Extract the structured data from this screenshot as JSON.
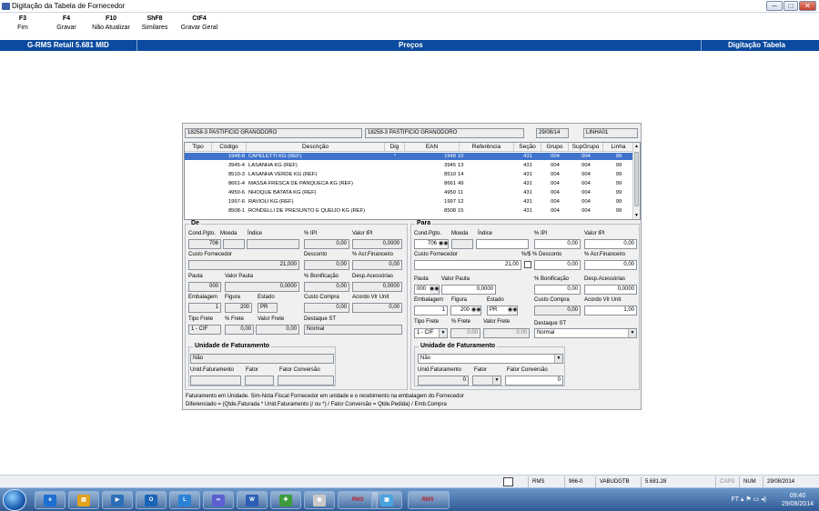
{
  "window": {
    "title": "Digitação da Tabela de Fornecedor",
    "controls": [
      "─",
      "□",
      "✕"
    ]
  },
  "toolbar": [
    {
      "key": "F3",
      "label": "Fim"
    },
    {
      "key": "F4",
      "label": "Gravar"
    },
    {
      "key": "F10",
      "label": "Não Atualizar"
    },
    {
      "key": "ShF8",
      "label": "Similares"
    },
    {
      "key": "CtF4",
      "label": "Gravar Geral"
    }
  ],
  "header": {
    "app": "G-RMS Retail 5.681 MID",
    "center": "Preços",
    "right": "Digitação Tabela"
  },
  "top_fields": {
    "supplier_code1": "18258-3",
    "supplier_name1": "PASTIFICIO GRANODORO",
    "supplier_code2": "18258-3",
    "supplier_name2": "PASTIFICIO GRANODORO",
    "date": "29/08/14",
    "line": "LINHA01"
  },
  "grid": {
    "headers": [
      "Tipo",
      "Código",
      "Descrição",
      "Dig",
      "EAN",
      "Referência",
      "Seção",
      "Grupo",
      "SupGrupo",
      "Linha"
    ],
    "rows": [
      {
        "tipo": "",
        "codigo": "1948-8",
        "descricao": "CAPELETTI KG (REF)",
        "dig": "*",
        "ean": "1948",
        "ref": "10",
        "secao": "431",
        "grupo": "004",
        "supgrupo": "004",
        "linha": "99"
      },
      {
        "tipo": "",
        "codigo": "3945-4",
        "descricao": "LASANHA KG (REF)",
        "dig": "",
        "ean": "3945",
        "ref": "13",
        "secao": "431",
        "grupo": "004",
        "supgrupo": "004",
        "linha": "99"
      },
      {
        "tipo": "",
        "codigo": "8510-3",
        "descricao": "LASANHA VERDE KG (REF)",
        "dig": "",
        "ean": "8510",
        "ref": "14",
        "secao": "431",
        "grupo": "004",
        "supgrupo": "004",
        "linha": "99"
      },
      {
        "tipo": "",
        "codigo": "8661-4",
        "descricao": "MASSA FRESCA DE PANQUECA KG (REF)",
        "dig": "",
        "ean": "8661",
        "ref": "49",
        "secao": "431",
        "grupo": "004",
        "supgrupo": "004",
        "linha": "99"
      },
      {
        "tipo": "",
        "codigo": "4950-6",
        "descricao": "NHOQUE BATATA KG (REF)",
        "dig": "",
        "ean": "4950",
        "ref": "11",
        "secao": "431",
        "grupo": "004",
        "supgrupo": "004",
        "linha": "99"
      },
      {
        "tipo": "",
        "codigo": "1997-6",
        "descricao": "RAVIOLI KG (REF)",
        "dig": "",
        "ean": "1997",
        "ref": "12",
        "secao": "431",
        "grupo": "004",
        "supgrupo": "004",
        "linha": "99"
      },
      {
        "tipo": "",
        "codigo": "8508-1",
        "descricao": "RONDELLI DE PRESUNTO E QUEIJO KG (REF)",
        "dig": "",
        "ean": "8508",
        "ref": "15",
        "secao": "431",
        "grupo": "004",
        "supgrupo": "004",
        "linha": "99"
      }
    ]
  },
  "de": {
    "title": "De",
    "labels": {
      "cond_pgto": "Cond.Pgto.",
      "moeda": "Moeda",
      "indice": "Índice",
      "ipi": "% IPI",
      "valor_ipi": "Valor IPI",
      "custo_fornecedor": "Custo Fornecedor",
      "desconto": "Desconto",
      "acr_financeiro": "% Acr.Financeiro",
      "pauta": "Pauta",
      "valor_pauta": "Valor Pauta",
      "bonificacao": "% Bonificação",
      "desp_acessorias": "Desp.Acessórias",
      "embalagem": "Embalagem",
      "figura": "Figura",
      "estado": "Estado",
      "custo_compra": "Custo Compra",
      "acordo_vlr_unit": "Acordo Vlr Unit",
      "tipo_frete": "Tipo Frete",
      "pct_frete": "% Frete",
      "valor_frete": "Valor Frete",
      "destaque_st": "Destaque ST"
    },
    "values": {
      "cond_pgto": "706",
      "moeda": "",
      "indice": "",
      "ipi": "0,00",
      "valor_ipi": "0,0000",
      "custo_fornecedor": "21,000",
      "desconto": "0,00",
      "acr_financeiro": "0,00",
      "pauta": "000",
      "valor_pauta": "0,0000",
      "bonificacao": "0,00",
      "desp_acessorias": "0,0000",
      "embalagem": "1",
      "figura": "200",
      "estado": "PR",
      "custo_compra": "0,00",
      "acordo_vlr_unit": "0,00",
      "tipo_frete": "1 - CIF",
      "pct_frete": "0,00",
      "valor_frete": "0,00",
      "destaque_st": "Normal"
    },
    "unidade": {
      "title": "Unidade de Faturamento",
      "value": "Não",
      "label_unid": "Unid.Faturamento",
      "label_fator": "Fator",
      "label_conv": "Fator Conversão",
      "unid": "",
      "fator": "",
      "conv": ""
    }
  },
  "para": {
    "title": "Para",
    "labels": {
      "cond_pgto": "Cond.Pgto.",
      "moeda": "Moeda",
      "indice": "Índice",
      "ipi": "% IPI",
      "valor_ipi": "Valor IPI",
      "custo_fornecedor": "Custo Fornecedor",
      "desconto": "%/$ % Desconto",
      "acr_financeiro": "% Acr.Financeiro",
      "pauta": "Pauta",
      "valor_pauta": "Valor Pauta",
      "bonificacao": "% Bonificação",
      "desp_acessorias": "Desp.Acessórias",
      "embalagem": "Embalagem",
      "figura": "Figura",
      "estado": "Estado",
      "custo_compra": "Custo Compra",
      "acordo_vlr_unit": "Acordo Vlr Unit",
      "tipo_frete": "Tipo Frete",
      "pct_frete": "% Frete",
      "valor_frete": "Valor Frete",
      "destaque_st": "Destaque ST"
    },
    "values": {
      "cond_pgto": "706",
      "moeda": "",
      "indice": "",
      "ipi": "0,00",
      "valor_ipi": "0,00",
      "custo_fornecedor": "21,00",
      "desconto": "0,00",
      "acr_financeiro": "0,00",
      "pauta": "000",
      "valor_pauta": "0,0000",
      "bonificacao": "0,00",
      "desp_acessorias": "0,0000",
      "embalagem": "1",
      "figura": "200",
      "estado": "PR",
      "custo_compra": "0,00",
      "acordo_vlr_unit": "1,00",
      "tipo_frete": "1 - CIF",
      "pct_frete": "0,00",
      "valor_frete": "0,00",
      "destaque_st": "Normal"
    },
    "unidade": {
      "title": "Unidade de Faturamento",
      "value": "Não",
      "label_unid": "Unid.Faturamento",
      "label_fator": "Fator",
      "label_conv": "Fator Conversão",
      "unid": "0",
      "fator": "",
      "conv": "0"
    }
  },
  "notes": {
    "line1": "Faturamento em Unidade. Sim-Nota Fiscal Fornecedor em unidade e o recebimento na embalagem do Fornecedor",
    "line2": "Diferenciado = (Qtde.Faturada * Unid.Faturamento (/ ou *) / Fator Conversão  = Qtde.Pedida) / Emb.Compra"
  },
  "statusbar": {
    "rms": "RMS",
    "code": "966-0",
    "user": "VABUDGTB",
    "version": "5.681.28",
    "caps": "CAPS",
    "num": "NUM",
    "date": "29/08/2014"
  },
  "taskbar": {
    "apps": [
      "IE",
      "Explorer",
      "Media",
      "Outlook",
      "Lync",
      "Sync",
      "Word",
      "Install",
      "Chrome",
      "RMS",
      "Screen",
      "RMS"
    ],
    "tray_lang": "FT",
    "time": "09:40",
    "date": "29/08/2014"
  },
  "colors": {
    "header_blue": "#0b4a9e",
    "selected_row": "#3f73cc",
    "panel_bg": "#f0f0f0"
  }
}
